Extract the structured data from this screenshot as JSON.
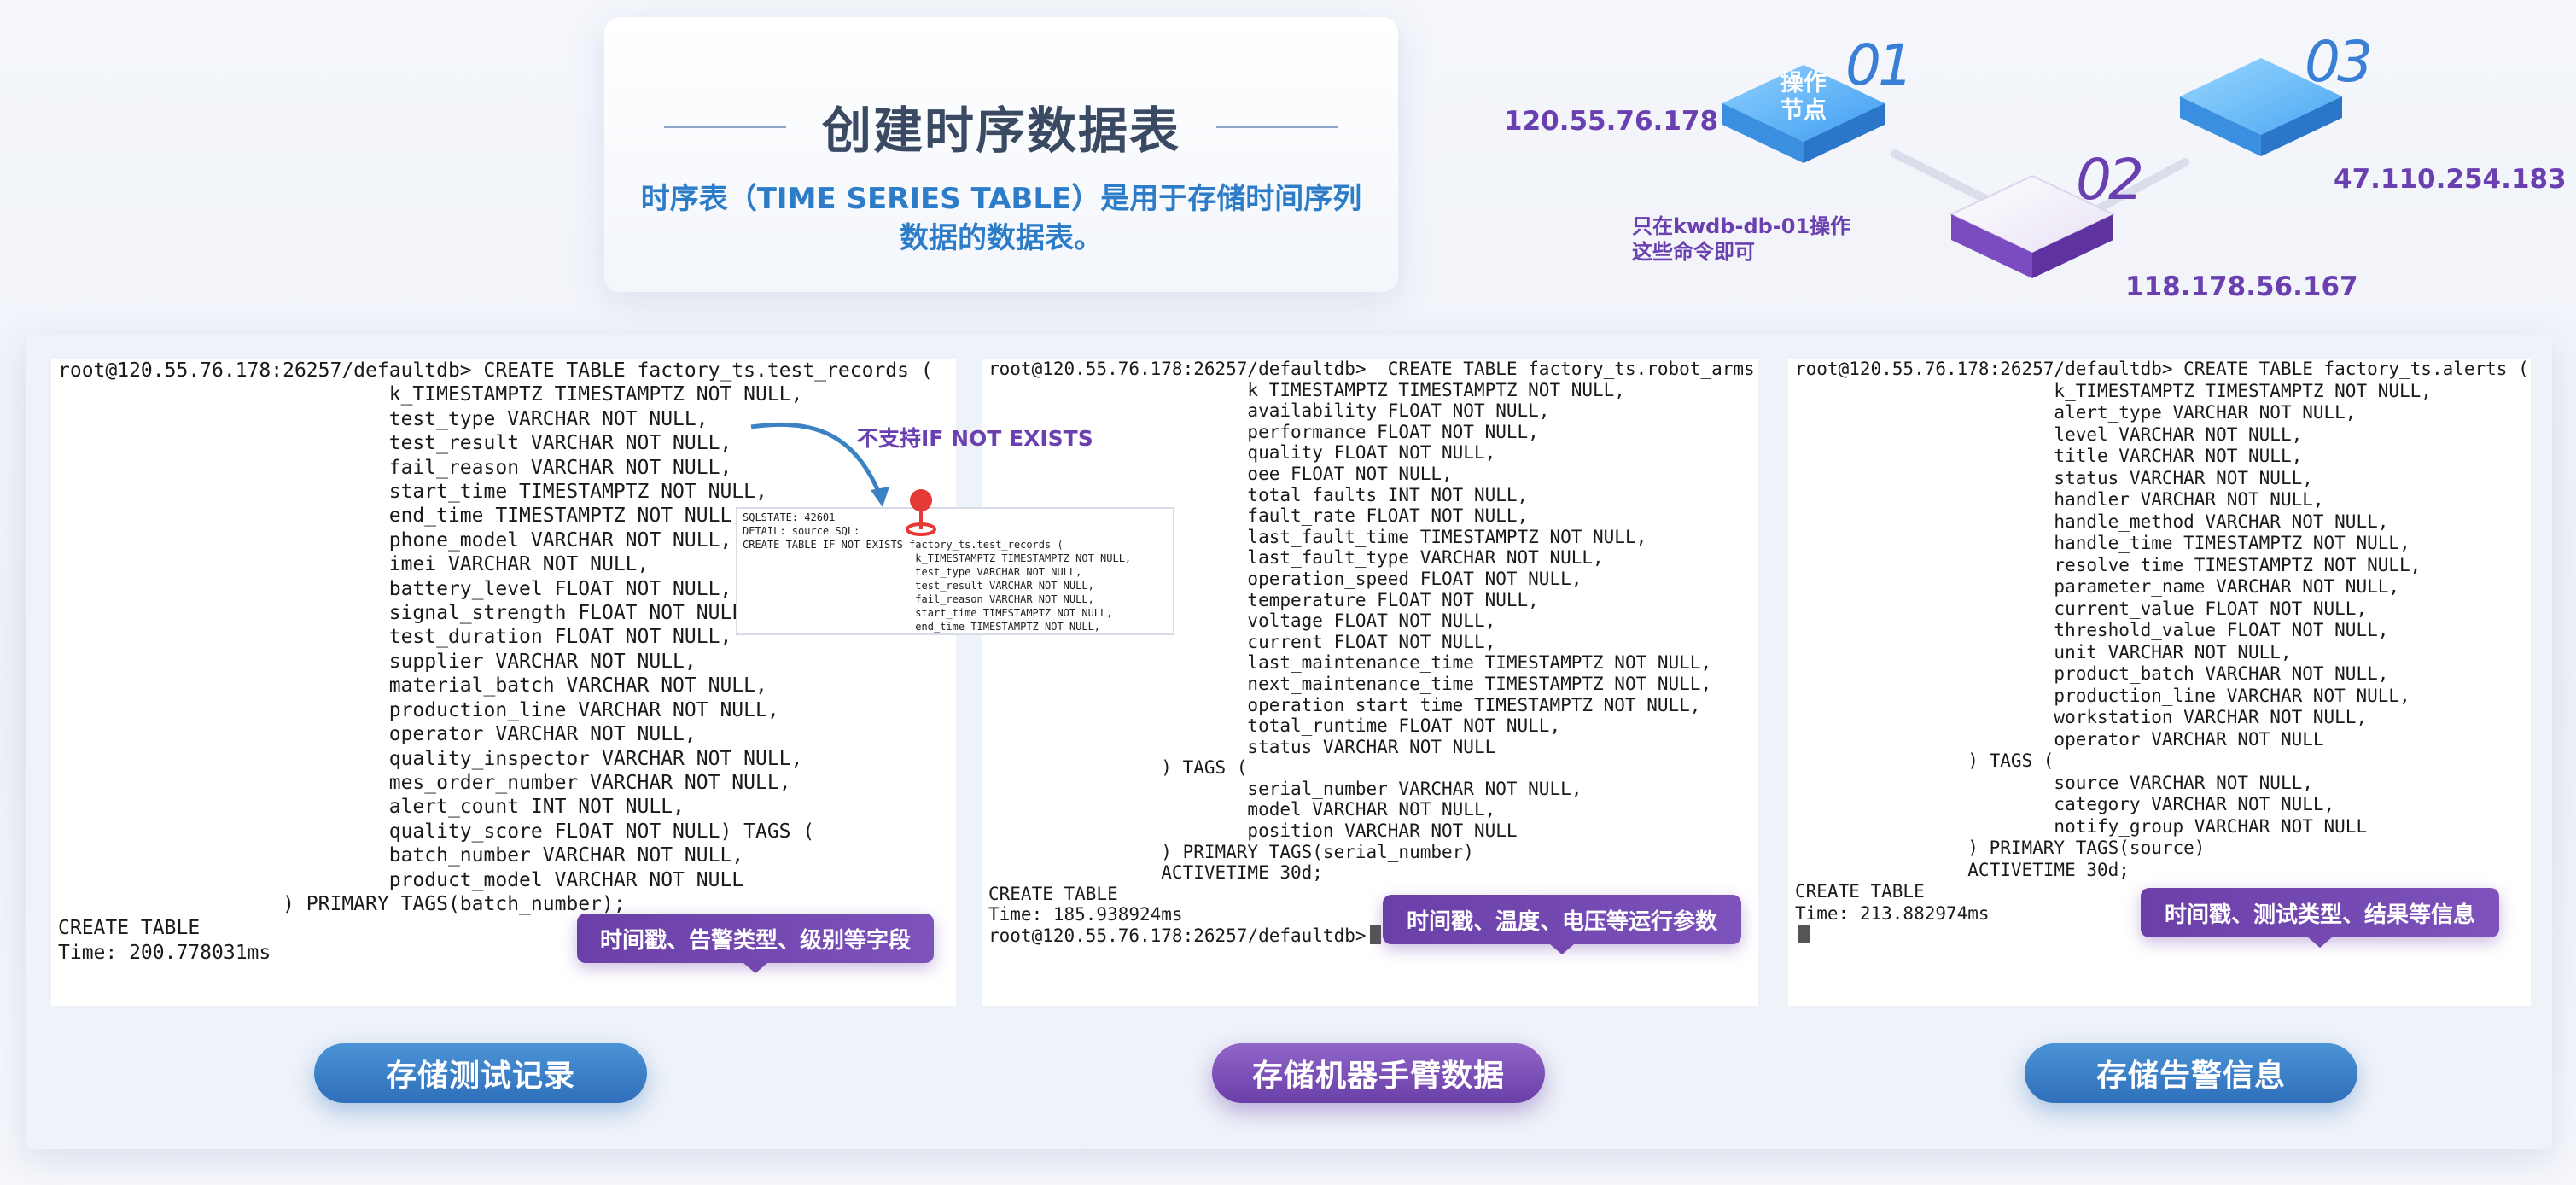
{
  "title": "创建时序数据表",
  "subtitle": "时序表（TIME SERIES TABLE）是用于存储时间序列数据的数据表。",
  "nodes": {
    "node1": {
      "label_line1": "操作",
      "label_line2": "节点",
      "number": "01",
      "ip": "120.55.76.178"
    },
    "node2": {
      "number": "02",
      "ip": "118.178.56.167"
    },
    "node3": {
      "number": "03",
      "ip": "47.110.254.183"
    },
    "note_line1": "只在kwdb-db-01操作",
    "note_line2": "这些命令即可",
    "colors": {
      "blue": "#4fa8f0",
      "purple": "#7b4cc0",
      "accent_purple": "#6a3fb0"
    }
  },
  "terminals": [
    {
      "lines": [
        "root@120.55.76.178:26257/defaultdb> CREATE TABLE factory_ts.test_records (",
        "                            k_TIMESTAMPTZ TIMESTAMPTZ NOT NULL,",
        "                            test_type VARCHAR NOT NULL,",
        "                            test_result VARCHAR NOT NULL,",
        "                            fail_reason VARCHAR NOT NULL,",
        "                            start_time TIMESTAMPTZ NOT NULL,",
        "                            end_time TIMESTAMPTZ NOT NULL,",
        "                            phone_model VARCHAR NOT NULL,",
        "                            imei VARCHAR NOT NULL,",
        "                            battery_level FLOAT NOT NULL,",
        "                            signal_strength FLOAT NOT NULL,",
        "                            test_duration FLOAT NOT NULL,",
        "                            supplier VARCHAR NOT NULL,",
        "                            material_batch VARCHAR NOT NULL,",
        "                            production_line VARCHAR NOT NULL,",
        "                            operator VARCHAR NOT NULL,",
        "                            quality_inspector VARCHAR NOT NULL,",
        "                            mes_order_number VARCHAR NOT NULL,",
        "                            alert_count INT NOT NULL,",
        "                            quality_score FLOAT NOT NULL) TAGS (",
        "                            batch_number VARCHAR NOT NULL,",
        "                            product_model VARCHAR NOT NULL",
        "                   ) PRIMARY TAGS(batch_number);",
        "CREATE TABLE",
        "",
        "Time: 200.778031ms"
      ]
    },
    {
      "lines": [
        "root@120.55.76.178:26257/defaultdb>  CREATE TABLE factory_ts.robot_arms (",
        "                        k_TIMESTAMPTZ TIMESTAMPTZ NOT NULL,",
        "                        availability FLOAT NOT NULL,",
        "                        performance FLOAT NOT NULL,",
        "                        quality FLOAT NOT NULL,",
        "                        oee FLOAT NOT NULL,",
        "                        total_faults INT NOT NULL,",
        "                        fault_rate FLOAT NOT NULL,",
        "                        last_fault_time TIMESTAMPTZ NOT NULL,",
        "                        last_fault_type VARCHAR NOT NULL,",
        "                        operation_speed FLOAT NOT NULL,",
        "                        temperature FLOAT NOT NULL,",
        "                        voltage FLOAT NOT NULL,",
        "                        current FLOAT NOT NULL,",
        "                        last_maintenance_time TIMESTAMPTZ NOT NULL,",
        "                        next_maintenance_time TIMESTAMPTZ NOT NULL,",
        "                        operation_start_time TIMESTAMPTZ NOT NULL,",
        "                        total_runtime FLOAT NOT NULL,",
        "                        status VARCHAR NOT NULL",
        "                ) TAGS (",
        "                        serial_number VARCHAR NOT NULL,",
        "                        model VARCHAR NOT NULL,",
        "                        position VARCHAR NOT NULL",
        "                ) PRIMARY TAGS(serial_number)",
        "                ACTIVETIME 30d;",
        "CREATE TABLE",
        "",
        "Time: 185.938924ms",
        "",
        "root@120.55.76.178:26257/defaultdb>"
      ]
    },
    {
      "lines": [
        "root@120.55.76.178:26257/defaultdb> CREATE TABLE factory_ts.alerts (",
        "                        k_TIMESTAMPTZ TIMESTAMPTZ NOT NULL,",
        "                        alert_type VARCHAR NOT NULL,",
        "                        level VARCHAR NOT NULL,",
        "                        title VARCHAR NOT NULL,",
        "                        status VARCHAR NOT NULL,",
        "                        handler VARCHAR NOT NULL,",
        "                        handle_method VARCHAR NOT NULL,",
        "                        handle_time TIMESTAMPTZ NOT NULL,",
        "                        resolve_time TIMESTAMPTZ NOT NULL,",
        "                        parameter_name VARCHAR NOT NULL,",
        "                        current_value FLOAT NOT NULL,",
        "                        threshold_value FLOAT NOT NULL,",
        "                        unit VARCHAR NOT NULL,",
        "                        product_batch VARCHAR NOT NULL,",
        "                        production_line VARCHAR NOT NULL,",
        "                        workstation VARCHAR NOT NULL,",
        "                        operator VARCHAR NOT NULL",
        "                ) TAGS (",
        "                        source VARCHAR NOT NULL,",
        "                        category VARCHAR NOT NULL,",
        "                        notify_group VARCHAR NOT NULL",
        "                ) PRIMARY TAGS(source)",
        "                ACTIVETIME 30d;",
        "CREATE TABLE",
        "",
        "Time: 213.882974ms",
        "",
        "root@120.55.76.178:26257/defaultdb>"
      ]
    }
  ],
  "error_popup": {
    "lines": [
      "SQLSTATE: 42601",
      "DETAIL: source SQL:",
      "CREATE TABLE IF NOT EXISTS factory_ts.test_records (",
      "                            k_TIMESTAMPTZ TIMESTAMPTZ NOT NULL,",
      "                            test_type VARCHAR NOT NULL,",
      "                            test_result VARCHAR NOT NULL,",
      "                            fail_reason VARCHAR NOT NULL,",
      "                            start_time TIMESTAMPTZ NOT NULL,",
      "                            end_time TIMESTAMPTZ NOT NULL,"
    ],
    "note": "不支持IF NOT EXISTS"
  },
  "callouts": {
    "first": "时间戳、告警类型、级别等字段",
    "second": "时间戳、温度、电压等运行参数",
    "third": "时间戳、测试类型、结果等信息"
  },
  "buttons": {
    "test_records": "存储测试记录",
    "robot_arms": "存储机器手臂数据",
    "alerts": "存储告警信息"
  }
}
